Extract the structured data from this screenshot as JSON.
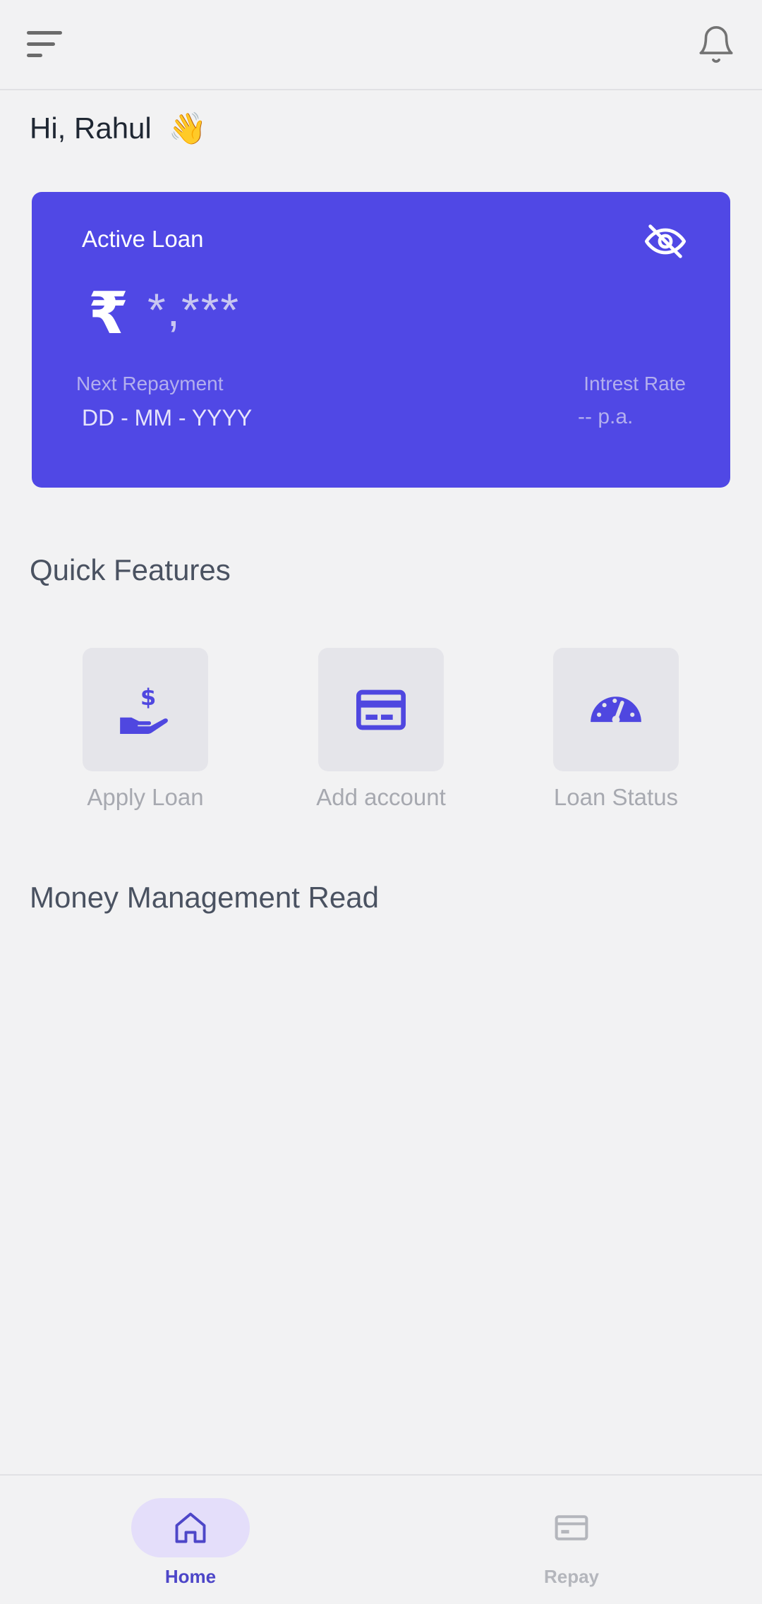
{
  "header": {
    "menu_icon": "menu-icon",
    "notification_icon": "bell-icon"
  },
  "greeting": {
    "text": "Hi, Rahul",
    "emoji": "👋"
  },
  "loan_card": {
    "title": "Active Loan",
    "visibility_icon": "eye-off-icon",
    "currency_symbol": "₹",
    "amount": "*,***",
    "next_repayment_label": "Next Repayment",
    "next_repayment_value": "DD - MM - YYYY",
    "interest_rate_label": "Intrest Rate",
    "interest_rate_value": "-- p.a.",
    "color": "#5048e5"
  },
  "quick_features": {
    "title": "Quick Features",
    "items": [
      {
        "label": "Apply Loan",
        "icon": "hand-dollar-icon"
      },
      {
        "label": "Add account",
        "icon": "credit-card-icon"
      },
      {
        "label": "Loan Status",
        "icon": "speedometer-icon"
      }
    ]
  },
  "money_management": {
    "title": "Money Management Read"
  },
  "bottom_nav": {
    "items": [
      {
        "label": "Home",
        "icon": "home-icon",
        "active": true
      },
      {
        "label": "Repay",
        "icon": "card-icon",
        "active": false
      }
    ]
  },
  "colors": {
    "accent": "#5048e5",
    "nav_active": "#4d46c8",
    "nav_active_bg": "#e4defa",
    "background": "#f2f2f3"
  }
}
